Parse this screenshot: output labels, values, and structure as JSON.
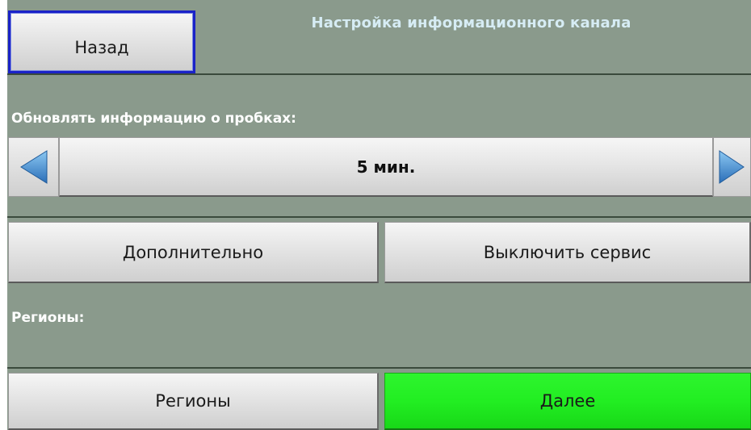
{
  "header": {
    "back_label": "Назад",
    "title": "Настройка информационного канала"
  },
  "update": {
    "label": "Обновлять информацию о пробках:",
    "value": "5 мин."
  },
  "actions": {
    "more_label": "Дополнительно",
    "disable_label": "Выключить сервис"
  },
  "regions": {
    "label": "Регионы:",
    "button_label": "Регионы"
  },
  "footer": {
    "next_label": "Далее"
  },
  "colors": {
    "background": "#8a9a8c",
    "title_text": "#d6ecf4",
    "next_button": "#22ee22",
    "back_border": "#1a22c8",
    "arrow": "#3d8fd6"
  },
  "icons": {
    "left": "arrow-left-icon",
    "right": "arrow-right-icon"
  }
}
